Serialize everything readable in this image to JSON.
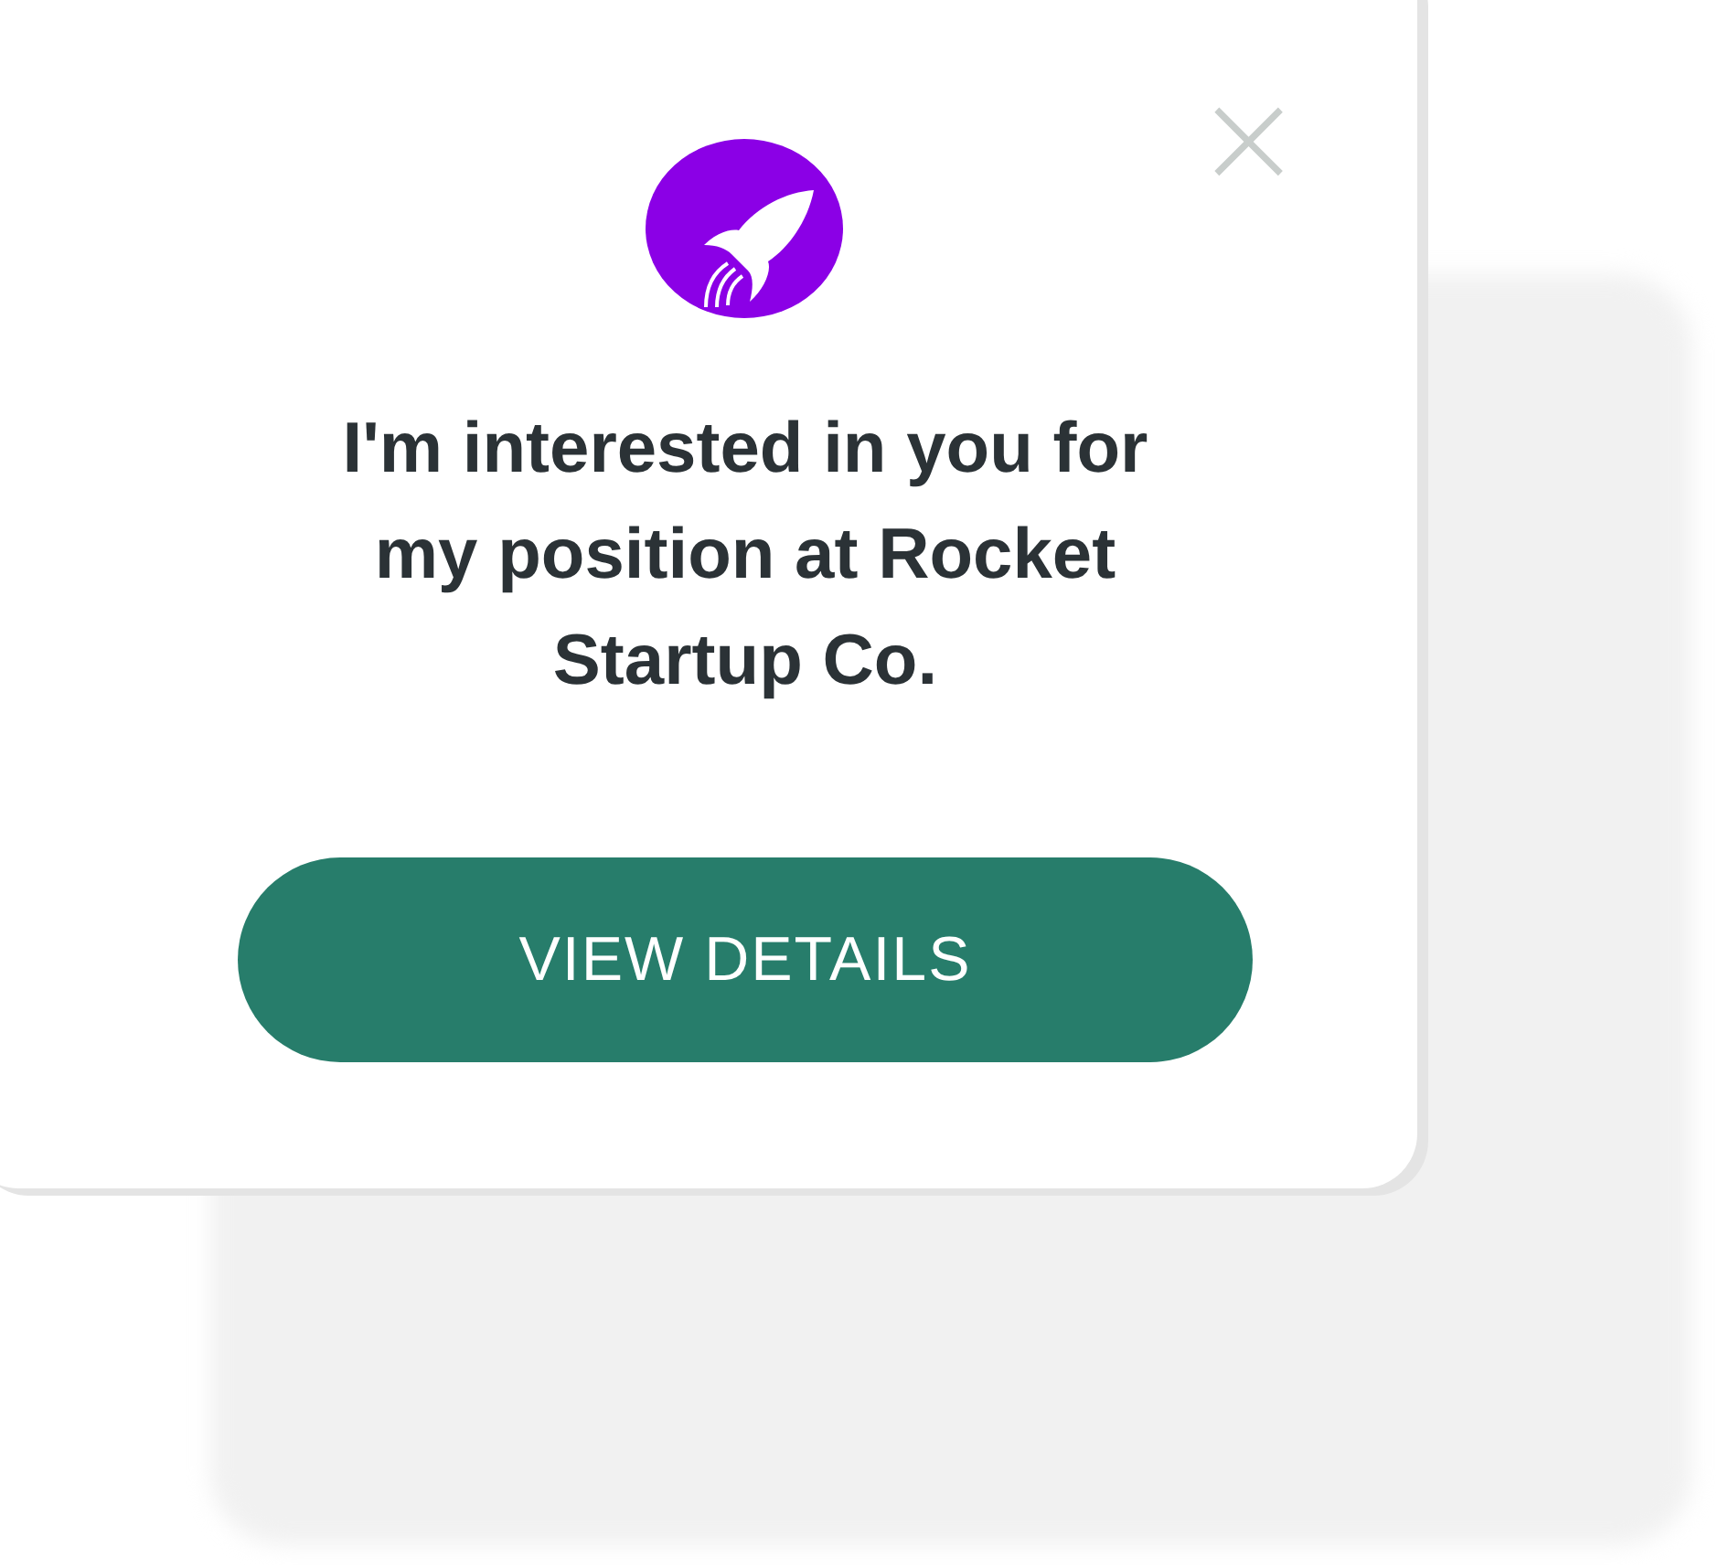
{
  "dialog": {
    "close": "×",
    "heading": "I'm interested in you for my position at Rocket Startup Co.",
    "button": "VIEW DETAILS"
  }
}
